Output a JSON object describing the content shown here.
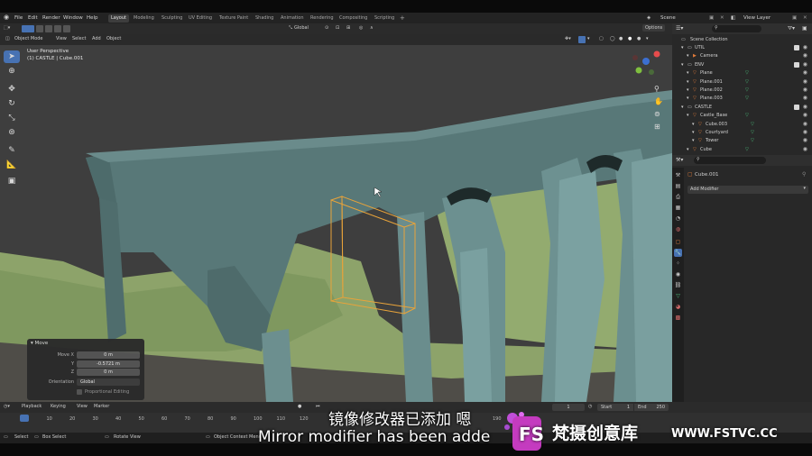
{
  "menu": {
    "items": [
      "File",
      "Edit",
      "Render",
      "Window",
      "Help"
    ],
    "workspaces": [
      "Layout",
      "Modeling",
      "Sculpting",
      "UV Editing",
      "Texture Paint",
      "Shading",
      "Animation",
      "Rendering",
      "Compositing",
      "Scripting"
    ],
    "active_workspace": "Layout",
    "add_tab": "+",
    "scene_label": "Scene",
    "view_layer_label": "View Layer"
  },
  "viewport_header": {
    "mode": "Object Mode",
    "menus": [
      "View",
      "Select",
      "Add",
      "Object"
    ],
    "orientation": "Global",
    "options": "Options"
  },
  "viewport": {
    "perspective": "User Perspective",
    "object_info": "(1) CASTLE | Cube.001"
  },
  "operator_panel": {
    "title": "Move",
    "rows": [
      {
        "label": "Move X",
        "value": "0 m"
      },
      {
        "label": "Y",
        "value": "-0.5721 m"
      },
      {
        "label": "Z",
        "value": "0 m"
      },
      {
        "label": "Orientation",
        "value": "Global"
      }
    ],
    "proportional": "Proportional Editing"
  },
  "outliner": {
    "title": "Scene Collection",
    "rows": [
      {
        "label": "UTIL",
        "indent": 0,
        "type": "collection"
      },
      {
        "label": "Camera",
        "indent": 1,
        "type": "camera"
      },
      {
        "label": "ENV",
        "indent": 0,
        "type": "collection"
      },
      {
        "label": "Plane",
        "indent": 1,
        "type": "mesh"
      },
      {
        "label": "Plane.001",
        "indent": 1,
        "type": "mesh"
      },
      {
        "label": "Plane.002",
        "indent": 1,
        "type": "mesh"
      },
      {
        "label": "Plane.003",
        "indent": 1,
        "type": "mesh"
      },
      {
        "label": "CASTLE",
        "indent": 0,
        "type": "collection"
      },
      {
        "label": "Castle_Base",
        "indent": 1,
        "type": "mesh"
      },
      {
        "label": "Cube.003",
        "indent": 2,
        "type": "mesh"
      },
      {
        "label": "Courtyard",
        "indent": 2,
        "type": "mesh"
      },
      {
        "label": "Tower",
        "indent": 2,
        "type": "mesh"
      },
      {
        "label": "Cube",
        "indent": 1,
        "type": "mesh"
      }
    ]
  },
  "properties": {
    "object_name": "Cube.001",
    "add_modifier": "Add Modifier"
  },
  "timeline": {
    "menus": [
      "Playback",
      "Keying",
      "View",
      "Marker"
    ],
    "current_frame": "1",
    "start_label": "Start",
    "start": "1",
    "end_label": "End",
    "end": "250",
    "ticks": [
      "1",
      "10",
      "20",
      "30",
      "40",
      "50",
      "60",
      "70",
      "80",
      "90",
      "100",
      "110",
      "120",
      "190"
    ]
  },
  "statusbar": {
    "items": [
      "Select",
      "Box Select",
      "Rotate View",
      "Object Context Menu"
    ]
  },
  "subtitles": {
    "chinese": "镜像修改器已添加 嗯",
    "english": "Mirror modifier has been adde"
  },
  "watermark": {
    "logo_letters": "FS",
    "brand": "梵摄创意库",
    "url": "WWW.FSTVC.CC"
  },
  "colors": {
    "accent_blue": "#4772b3",
    "selection_orange": "#e8a33a",
    "castle_wall": "#5b7b7b",
    "grass": "#8fa66a",
    "mesh_icon_green": "#4cc17e",
    "object_icon_orange": "#e07b3a"
  }
}
